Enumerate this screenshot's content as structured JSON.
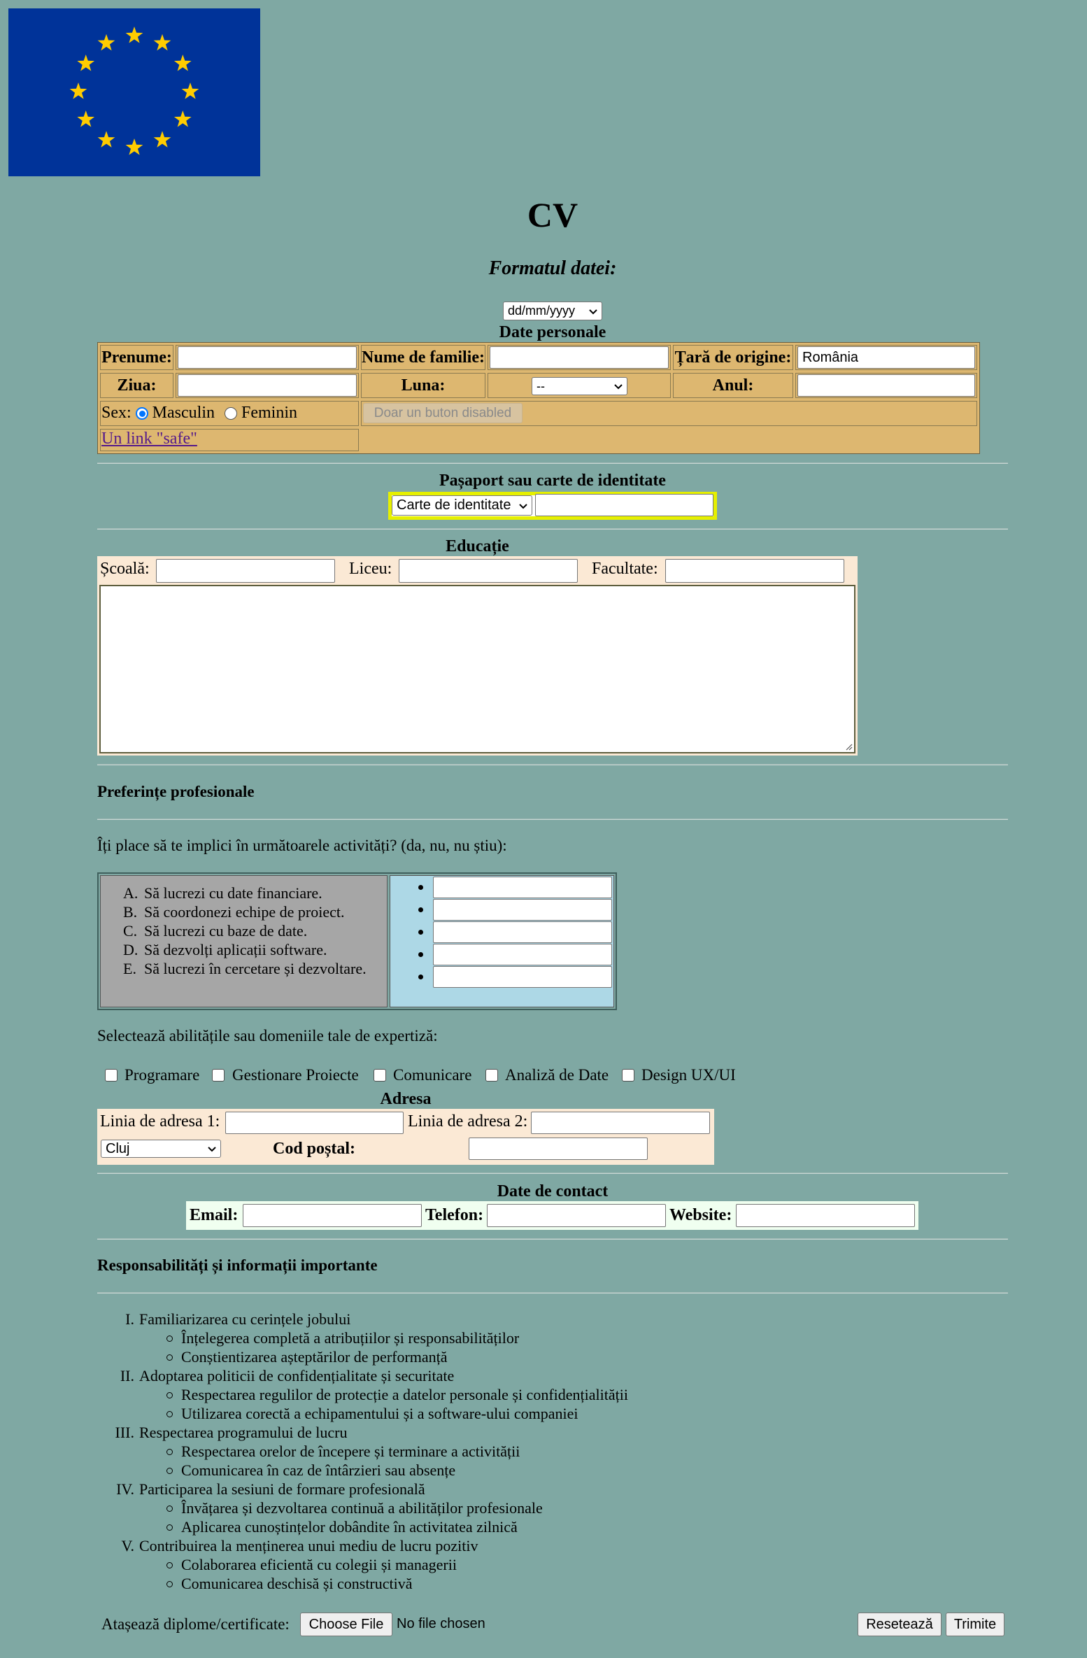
{
  "header": {
    "title": "CV",
    "subtitle": "Formatul datei:",
    "date_format": "dd/mm/yyyy"
  },
  "personal": {
    "heading": "Date personale",
    "first_name_label": "Prenume:",
    "last_name_label": "Nume de familie:",
    "country_label": "Țară de origine:",
    "country_value": "România",
    "day_label": "Ziua:",
    "month_label": "Luna:",
    "month_value": "--",
    "year_label": "Anul:",
    "sex_label": "Sex:",
    "sex_options": [
      "Masculin",
      "Feminin"
    ],
    "sex_selected": "Masculin",
    "disabled_button": "Doar un buton disabled",
    "link": "Un link \"safe\""
  },
  "passport": {
    "heading": "Pașaport sau carte de identitate",
    "doc_type": "Carte de identitate"
  },
  "education": {
    "heading": "Educație",
    "school_label": "Școală:",
    "highschool_label": "Liceu:",
    "faculty_label": "Facultate:"
  },
  "preferences": {
    "heading": "Preferințe profesionale",
    "question": "Îți place să te implici în următoarele activități? (da, nu, nu știu):",
    "activities": [
      {
        "marker": "A.",
        "text": "Să lucrezi cu date financiare."
      },
      {
        "marker": "B.",
        "text": "Să coordonezi echipe de proiect."
      },
      {
        "marker": "C.",
        "text": "Să lucrezi cu baze de date."
      },
      {
        "marker": "D.",
        "text": "Să dezvolți aplicații software."
      },
      {
        "marker": "E.",
        "text": "Să lucrezi în cercetare și dezvoltare."
      }
    ],
    "skills_question": "Selectează abilitățile sau domeniile tale de expertiză:",
    "skills": [
      "Programare",
      "Gestionare Proiecte",
      "Comunicare",
      "Analiză de Date",
      "Design UX/UI"
    ]
  },
  "address": {
    "heading": "Adresa",
    "line1_label": "Linia de adresa 1:",
    "line2_label": "Linia de adresa 2:",
    "city": "Cluj",
    "postal_label": "Cod poștal:"
  },
  "contact": {
    "heading": "Date de contact",
    "email_label": "Email:",
    "phone_label": "Telefon:",
    "website_label": "Website:"
  },
  "responsibilities": {
    "heading": "Responsabilități și informații importante",
    "items": [
      {
        "marker": "I.",
        "text": "Familiarizarea cu cerințele jobului",
        "sub": [
          "Înțelegerea completă a atribuțiilor și responsabilităților",
          "Conștientizarea așteptărilor de performanță"
        ]
      },
      {
        "marker": "II.",
        "text": "Adoptarea politicii de confidențialitate și securitate",
        "sub": [
          "Respectarea regulilor de protecție a datelor personale și confidențialității",
          "Utilizarea corectă a echipamentului și a software-ului companiei"
        ]
      },
      {
        "marker": "III.",
        "text": "Respectarea programului de lucru",
        "sub": [
          "Respectarea orelor de începere și terminare a activității",
          "Comunicarea în caz de întârzieri sau absențe"
        ]
      },
      {
        "marker": "IV.",
        "text": "Participarea la sesiuni de formare profesională",
        "sub": [
          "Învățarea și dezvoltarea continuă a abilităților profesionale",
          "Aplicarea cunoștințelor dobândite în activitatea zilnică"
        ]
      },
      {
        "marker": "V.",
        "text": "Contribuirea la menținerea unui mediu de lucru pozitiv",
        "sub": [
          "Colaborarea eficientă cu colegii și managerii",
          "Comunicarea deschisă și constructivă"
        ]
      }
    ]
  },
  "footer": {
    "attach_label": "Atașează diplome/certificate:",
    "choose_file": "Choose File",
    "no_file": "No file chosen",
    "reset": "Resetează",
    "submit": "Trimite"
  },
  "colors": {
    "background": "#7fa8a3",
    "table_tan": "#ddb770",
    "cream": "#fbe9d5",
    "passport_border": "#e6f000",
    "flag_blue": "#003399",
    "flag_star": "#ffcc00",
    "activities_grey": "#a6a6a6",
    "activities_blue": "#add8e6"
  }
}
